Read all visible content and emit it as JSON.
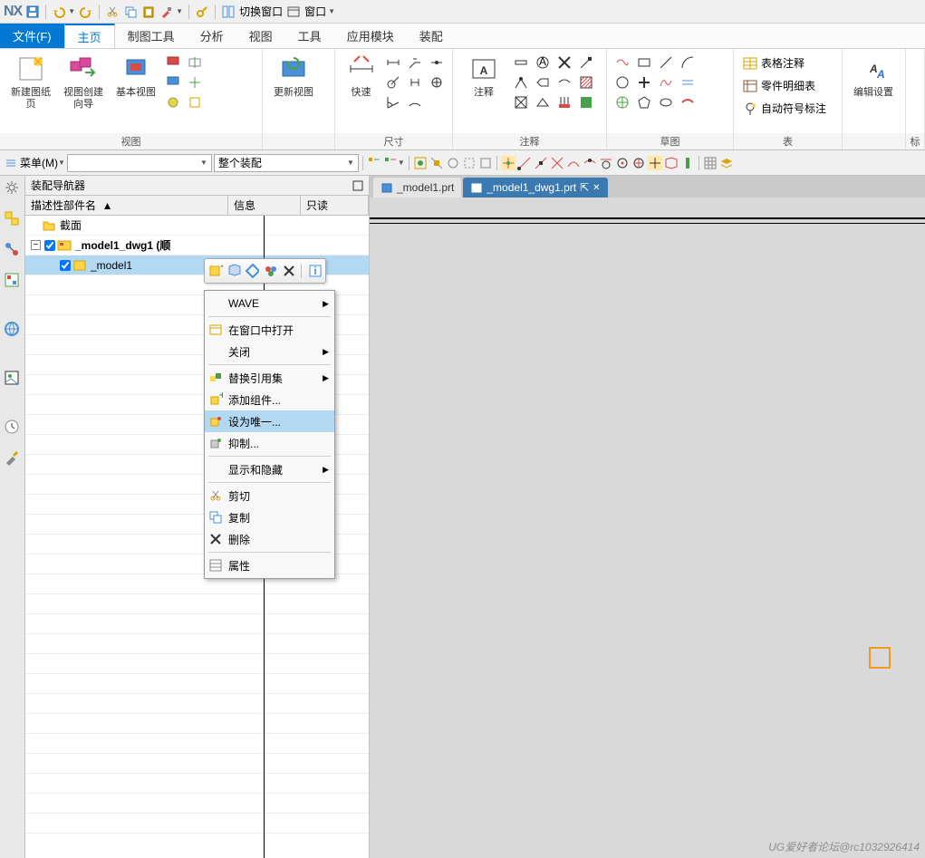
{
  "app": {
    "logo": "NX"
  },
  "titlebar": {
    "switch_window": "切换窗口",
    "window": "窗口"
  },
  "menu": {
    "file": "文件(F)",
    "home": "主页",
    "drafting": "制图工具",
    "analysis": "分析",
    "view": "视图",
    "tools": "工具",
    "app": "应用模块",
    "assembly": "装配"
  },
  "ribbon": {
    "new_sheet": "新建图纸页",
    "view_wizard": "视图创建向导",
    "base_view": "基本视图",
    "update_view": "更新视图",
    "rapid": "快速",
    "annotation": "注释",
    "table_annotation": "表格注释",
    "parts_list": "零件明细表",
    "auto_balloon": "自动符号标注",
    "edit_settings": "编辑设置",
    "mark": "标",
    "group_view": "视图",
    "group_dim": "尺寸",
    "group_anno": "注释",
    "group_sketch": "草图",
    "group_table": "表",
    "group_a_big": "A"
  },
  "toolbar2": {
    "menu_btn": "菜单(M)",
    "combo_assembly": "整个装配"
  },
  "nav": {
    "title": "装配导航器",
    "col_name": "描述性部件名",
    "col_info": "信息",
    "col_readonly": "只读",
    "section": "截面",
    "model1_dwg1": "_model1_dwg1  (顺",
    "model1": "_model1"
  },
  "tabs": {
    "tab1": "_model1.prt",
    "tab2": "_model1_dwg1.prt"
  },
  "ctx": {
    "wave": "WAVE",
    "open_in_window": "在窗口中打开",
    "close": "关闭",
    "replace_ref": "替换引用集",
    "add_component": "添加组件...",
    "make_unique": "设为唯一...",
    "suppress": "抑制...",
    "show_hide": "显示和隐藏",
    "cut": "剪切",
    "copy": "复制",
    "delete": "删除",
    "properties": "属性"
  },
  "watermark": "UG爱好者论坛@rc1032926414"
}
